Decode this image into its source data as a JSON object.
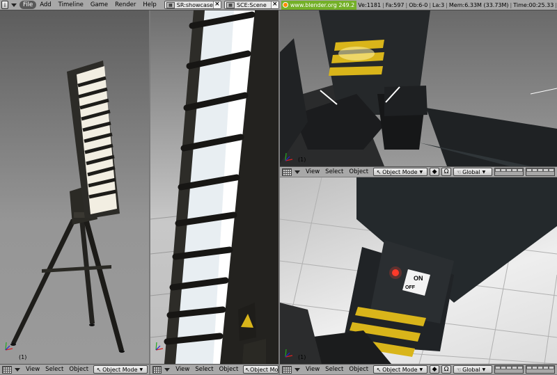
{
  "menubar": {
    "items": [
      "File",
      "Add",
      "Timeline",
      "Game",
      "Render",
      "Help"
    ],
    "screen": "SR:showcase",
    "scene": "SCE:Scene",
    "website": "www.blender.org 249.2",
    "stats": {
      "verts": "Ve:1181",
      "faces": "Fa:597",
      "objects": "Ob:6-0",
      "lamps": "La:3",
      "memory": "Mem:6.33M (33.73M)",
      "time": "Time:00:25.33"
    }
  },
  "viewport": {
    "frame": "(1)",
    "view": "View",
    "select": "Select",
    "object": "Object",
    "mode": "Object Mode",
    "mode_short": "Object Mo",
    "orientation": "Global"
  },
  "switch_label": {
    "on": "ON",
    "off": "OFF"
  },
  "icons": {
    "window": "window-type-icon",
    "grid": "grid-icon",
    "pivot": "pivot-icon",
    "manipulator": "manipulator-icon",
    "hand": "hand-icon",
    "layers": "layer-icon"
  },
  "colors": {
    "header_bg": "#a8a8a8",
    "active_menu": "#585858",
    "website_bg": "#74b028",
    "stripe_yellow": "#d9b51a"
  }
}
